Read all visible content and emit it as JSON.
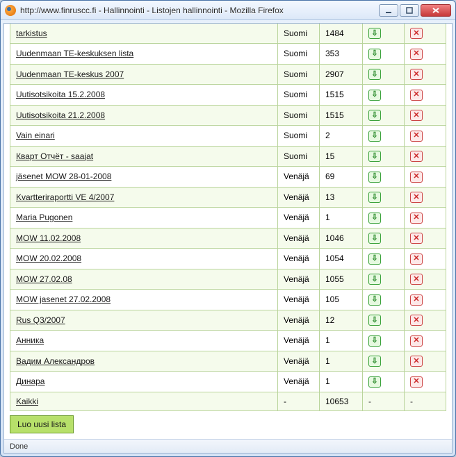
{
  "window": {
    "title": "http://www.finruscc.fi - Hallinnointi - Listojen hallinnointi - Mozilla Firefox"
  },
  "rows": [
    {
      "name": "tarkistus",
      "lang": "Suomi",
      "count": "1484",
      "has_download": true,
      "has_delete": true
    },
    {
      "name": "tarkistus",
      "lang": "Suomi",
      "count": "1484",
      "has_download": true,
      "has_delete": true
    },
    {
      "name": "Uudenmaan TE-keskuksen lista",
      "lang": "Suomi",
      "count": "353",
      "has_download": true,
      "has_delete": true
    },
    {
      "name": "Uudenmaan TE-keskus 2007",
      "lang": "Suomi",
      "count": "2907",
      "has_download": true,
      "has_delete": true
    },
    {
      "name": "Uutisotsikoita 15.2.2008",
      "lang": "Suomi",
      "count": "1515",
      "has_download": true,
      "has_delete": true
    },
    {
      "name": "Uutisotsikoita 21.2.2008",
      "lang": "Suomi",
      "count": "1515",
      "has_download": true,
      "has_delete": true
    },
    {
      "name": "Vain einari",
      "lang": "Suomi",
      "count": "2",
      "has_download": true,
      "has_delete": true
    },
    {
      "name": "Кварт Отчёт - saajat",
      "lang": "Suomi",
      "count": "15",
      "has_download": true,
      "has_delete": true
    },
    {
      "name": "jäsenet MOW 28-01-2008",
      "lang": "Venäjä",
      "count": "69",
      "has_download": true,
      "has_delete": true
    },
    {
      "name": "Kvartteriraportti VE 4/2007",
      "lang": "Venäjä",
      "count": "13",
      "has_download": true,
      "has_delete": true
    },
    {
      "name": "Maria Pugonen",
      "lang": "Venäjä",
      "count": "1",
      "has_download": true,
      "has_delete": true
    },
    {
      "name": "MOW 11.02.2008",
      "lang": "Venäjä",
      "count": "1046",
      "has_download": true,
      "has_delete": true
    },
    {
      "name": "MOW 20.02.2008",
      "lang": "Venäjä",
      "count": "1054",
      "has_download": true,
      "has_delete": true
    },
    {
      "name": "MOW 27.02.08",
      "lang": "Venäjä",
      "count": "1055",
      "has_download": true,
      "has_delete": true
    },
    {
      "name": "MOW jasenet 27.02.2008",
      "lang": "Venäjä",
      "count": "105",
      "has_download": true,
      "has_delete": true
    },
    {
      "name": "Rus Q3/2007",
      "lang": "Venäjä",
      "count": "12",
      "has_download": true,
      "has_delete": true
    },
    {
      "name": "Анника",
      "lang": "Venäjä",
      "count": "1",
      "has_download": true,
      "has_delete": true
    },
    {
      "name": "Вадим Александров",
      "lang": "Venäjä",
      "count": "1",
      "has_download": true,
      "has_delete": true
    },
    {
      "name": "Динара",
      "lang": "Venäjä",
      "count": "1",
      "has_download": true,
      "has_delete": true
    },
    {
      "name": "Kaikki",
      "lang": "-",
      "count": "10653",
      "has_download": false,
      "has_delete": false
    }
  ],
  "buttons": {
    "create_list": "Luo uusi lista"
  },
  "status": {
    "text": "Done"
  },
  "placeholders": {
    "dash": "-"
  }
}
